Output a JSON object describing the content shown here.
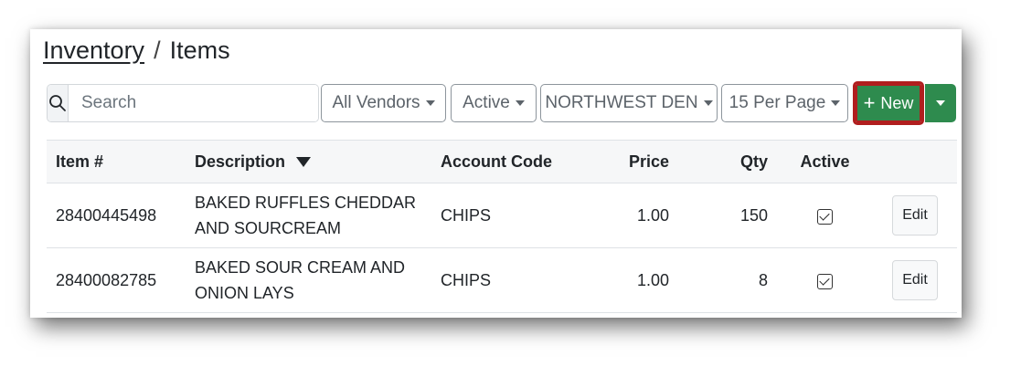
{
  "breadcrumb": {
    "parent": "Inventory",
    "separator": "/",
    "current": "Items"
  },
  "search": {
    "placeholder": "Search",
    "value": "",
    "icon": "search-icon"
  },
  "filters": [
    {
      "label": "All Vendors"
    },
    {
      "label": "Active"
    },
    {
      "label": "NORTHWEST DEN"
    },
    {
      "label": "15 Per Page"
    }
  ],
  "new_button": {
    "label": "New",
    "icon": "plus-icon",
    "color": "#2e8b4e",
    "highlight": "#b01e1e"
  },
  "table": {
    "headers": [
      "Item #",
      "Description",
      "Account Code",
      "Price",
      "Qty",
      "Active"
    ],
    "sort": {
      "column": "Description",
      "direction": "descending"
    },
    "rows": [
      {
        "item": "28400445498",
        "description_line1": "BAKED RUFFLES CHEDDAR",
        "description_line2": "AND SOURCREAM",
        "account": "CHIPS",
        "price": "1.00",
        "qty": "150",
        "active": true,
        "action": "Edit"
      },
      {
        "item": "28400082785",
        "description_line1": "BAKED SOUR CREAM AND",
        "description_line2": "ONION LAYS",
        "account": "CHIPS",
        "price": "1.00",
        "qty": "8",
        "active": true,
        "action": "Edit"
      }
    ]
  }
}
